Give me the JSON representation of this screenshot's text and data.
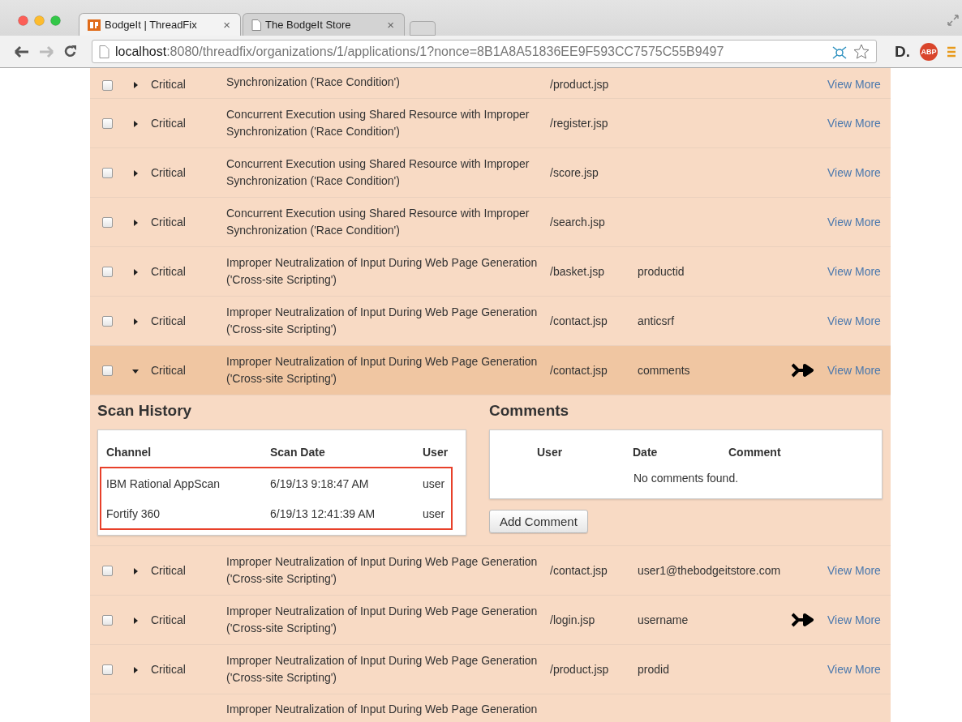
{
  "browser": {
    "tabs": [
      {
        "title": "BodgeIt | ThreadFix",
        "selected": true,
        "kind": "logo"
      },
      {
        "title": "The BodgeIt Store",
        "selected": false,
        "kind": "page"
      }
    ],
    "close_label": "×",
    "url_host": "localhost",
    "url_rest": ":8080/threadfix/organizations/1/applications/1?nonce=8B1A8A51836EE9F593CC7575C55B9497",
    "forward_disabled": true,
    "extensions": [
      {
        "kind": "letter",
        "label": "D."
      },
      {
        "kind": "badge",
        "label": "ABP"
      }
    ]
  },
  "rows": [
    {
      "kind": "cut-top",
      "checked": false,
      "expanded": false,
      "severity": "Critical",
      "description": [
        "Synchronization ('Race Condition')"
      ],
      "path": "/product.jsp",
      "merged": false,
      "link": "View More"
    },
    {
      "kind": "full",
      "checked": false,
      "expanded": false,
      "severity": "Critical",
      "description": [
        "Concurrent Execution using Shared Resource with Improper",
        "Synchronization ('Race Condition')"
      ],
      "path": "/register.jsp",
      "merged": false,
      "link": "View More"
    },
    {
      "kind": "full",
      "checked": false,
      "expanded": false,
      "severity": "Critical",
      "description": [
        "Concurrent Execution using Shared Resource with Improper",
        "Synchronization ('Race Condition')"
      ],
      "path": "/score.jsp",
      "merged": false,
      "link": "View More"
    },
    {
      "kind": "full",
      "checked": false,
      "expanded": false,
      "severity": "Critical",
      "description": [
        "Concurrent Execution using Shared Resource with Improper",
        "Synchronization ('Race Condition')"
      ],
      "path": "/search.jsp",
      "merged": false,
      "link": "View More"
    },
    {
      "kind": "full",
      "checked": false,
      "expanded": false,
      "severity": "Critical",
      "description": [
        "Improper Neutralization of Input During Web Page Generation",
        "('Cross-site Scripting')"
      ],
      "path": "/basket.jsp",
      "parameter": "productid",
      "merged": false,
      "link": "View More"
    },
    {
      "kind": "full",
      "checked": false,
      "expanded": false,
      "severity": "Critical",
      "description": [
        "Improper Neutralization of Input During Web Page Generation",
        "('Cross-site Scripting')"
      ],
      "path": "/contact.jsp",
      "parameter": "anticsrf",
      "merged": false,
      "link": "View More"
    },
    {
      "kind": "full",
      "checked": false,
      "expanded": true,
      "severity": "Critical",
      "description": [
        "Improper Neutralization of Input During Web Page Generation",
        "('Cross-site Scripting')"
      ],
      "path": "/contact.jsp",
      "parameter": "comments",
      "merged": true,
      "link": "View More",
      "detail": {
        "scan_history": {
          "title": "Scan History",
          "columns": [
            "Channel",
            "Scan Date",
            "User"
          ],
          "highlighted": true,
          "rows": [
            [
              "IBM Rational AppScan",
              "6/19/13 9:18:47 AM",
              "user"
            ],
            [
              "Fortify 360",
              "6/19/13 12:41:39 AM",
              "user"
            ]
          ]
        },
        "comments": {
          "title": "Comments",
          "columns": [
            "User",
            "Date",
            "Comment"
          ],
          "empty": "No comments found.",
          "button": "Add Comment"
        }
      }
    },
    {
      "kind": "full",
      "checked": false,
      "expanded": false,
      "severity": "Critical",
      "description": [
        "Improper Neutralization of Input During Web Page Generation",
        "('Cross-site Scripting')"
      ],
      "path": "/contact.jsp",
      "parameter": "user1@thebodgeitstore.com",
      "merged": false,
      "link": "View More"
    },
    {
      "kind": "full",
      "checked": false,
      "expanded": false,
      "severity": "Critical",
      "description": [
        "Improper Neutralization of Input During Web Page Generation",
        "('Cross-site Scripting')"
      ],
      "path": "/login.jsp",
      "parameter": "username",
      "merged": true,
      "link": "View More"
    },
    {
      "kind": "full",
      "checked": false,
      "expanded": false,
      "severity": "Critical",
      "description": [
        "Improper Neutralization of Input During Web Page Generation",
        "('Cross-site Scripting')"
      ],
      "path": "/product.jsp",
      "parameter": "prodid",
      "merged": false,
      "link": "View More"
    },
    {
      "kind": "cut-bottom",
      "description": [
        "Improper Neutralization of Input During Web Page Generation"
      ]
    }
  ]
}
